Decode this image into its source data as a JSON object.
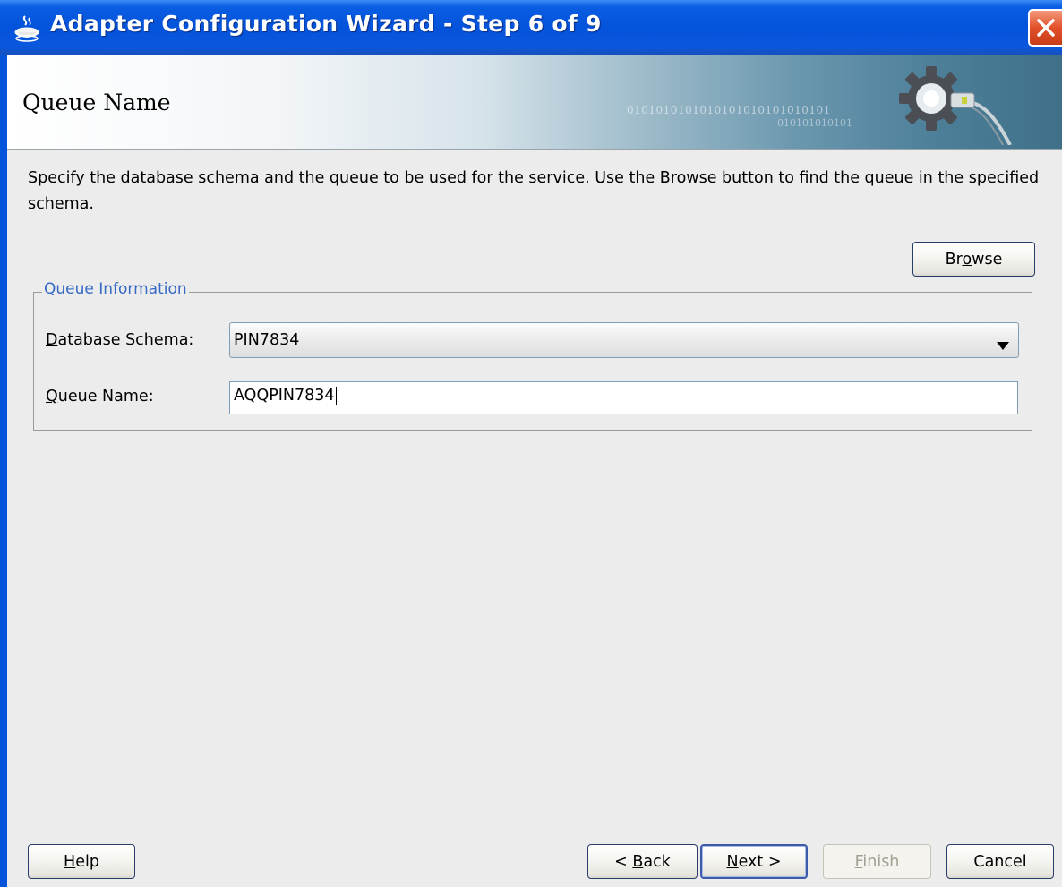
{
  "window": {
    "title": "Adapter Configuration Wizard - Step 6 of 9"
  },
  "banner": {
    "title": "Queue Name",
    "binary_line1": "0101010101010101010101010101",
    "binary_line2": "010101010101"
  },
  "instructions": "Specify the database schema and the queue to be used for the service. Use the Browse button to find the queue in the specified schema.",
  "browse_button": {
    "pre": "Br",
    "mnemonic": "o",
    "post": "wse"
  },
  "queue_information": {
    "legend": "Queue Information",
    "schema_label": {
      "mnemonic": "D",
      "rest": "atabase Schema:"
    },
    "schema_value": "PIN7834",
    "queue_label": {
      "mnemonic": "Q",
      "rest": "ueue Name:"
    },
    "queue_value": "AQQPIN7834"
  },
  "footer": {
    "help": {
      "mnemonic": "H",
      "rest": "elp"
    },
    "back": {
      "pre": "< ",
      "mnemonic": "B",
      "rest": "ack"
    },
    "next": {
      "mnemonic": "N",
      "rest": "ext >"
    },
    "finish": {
      "mnemonic": "F",
      "rest": "inish"
    },
    "cancel": "Cancel"
  },
  "colors": {
    "titlebar": "#0453db",
    "legend_text": "#3669c4",
    "background": "#ececec",
    "close_button": "#e2502a"
  },
  "icons": {
    "title_icon": "java-cup-icon",
    "close_icon": "close-x-icon",
    "banner_icon": "gear-plug-icon",
    "dropdown_icon": "dropdown-arrow-icon"
  }
}
